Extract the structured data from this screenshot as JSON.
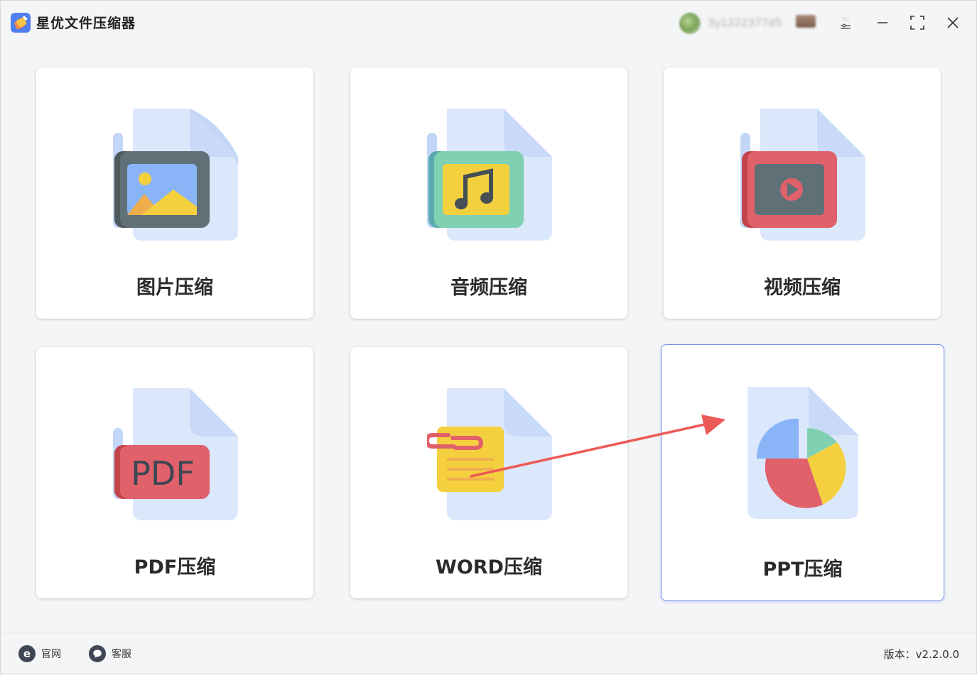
{
  "app": {
    "title": "星优文件压缩器",
    "user_name": "3y1222377d5"
  },
  "cards": [
    {
      "label": "图片压缩",
      "icon": "image-file-icon"
    },
    {
      "label": "音频压缩",
      "icon": "audio-file-icon"
    },
    {
      "label": "视频压缩",
      "icon": "video-file-icon"
    },
    {
      "label": "PDF压缩",
      "icon": "pdf-file-icon",
      "icon_text": "PDF"
    },
    {
      "label": "WORD压缩",
      "icon": "word-file-icon"
    },
    {
      "label": "PPT压缩",
      "icon": "ppt-file-icon",
      "selected": true
    }
  ],
  "footer": {
    "website_label": "官网",
    "website_icon_text": "e",
    "support_label": "客服",
    "version": "版本：v2.2.0.0"
  },
  "colors": {
    "accent": "#6f8fe8",
    "arrow": "#ec5a55",
    "file_back": "#dbe7fb",
    "file_fold": "#c3d6f7"
  }
}
